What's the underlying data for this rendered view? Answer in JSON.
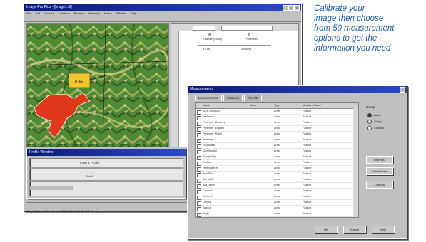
{
  "caption": {
    "lines": [
      "Calibrate your",
      "image then choose",
      "from 50 measurement",
      "options to get the",
      "information you need"
    ]
  },
  "main_window": {
    "title": "Image-Pro Plus - [Image1.tif]",
    "menu": [
      "File",
      "Edit",
      "Acquire",
      "Enhance",
      "Process",
      "Measure",
      "Macro",
      "Window",
      "Help"
    ],
    "spreadsheet": {
      "col_a": "A",
      "col_a_sub": "Feature (Count)",
      "col_b": "B",
      "col_b_sub": "Perimeter",
      "value_a": "87.15",
      "value_b": "2898.04"
    },
    "label_box": "Area",
    "status": "Inset 1 Data: 87 Ft. Cursor: 12,00 MSt: 0.12 Gsi: 4.5 Hz: 3",
    "colors": {
      "map_green": "#3f7a2e",
      "lake_red": "#e0381a",
      "label_yellow": "#f3c52b"
    }
  },
  "profile_window": {
    "title": "Profile Window",
    "labels": [
      "Inset 1 Profile",
      "Profile"
    ]
  },
  "measure_dialog": {
    "title": "Measurements",
    "tabs": [
      "Measurement",
      "Features",
      "Results"
    ],
    "columns": [
      "Name",
      "Value",
      "Type",
      "Measure Name"
    ],
    "rows": [
      {
        "name": "Area (Polygon)",
        "type": "Area",
        "measure": "Feature"
      },
      {
        "name": "Perimeter",
        "type": "Area",
        "measure": "Feature"
      },
      {
        "name": "Perimeter (Convex)",
        "type": "Area",
        "measure": "Feature"
      },
      {
        "name": "Perimeter (Ellipse)",
        "type": "Area",
        "measure": "Feature"
      },
      {
        "name": "Perimeter (Ratio)",
        "type": "Area",
        "measure": "Feature"
      },
      {
        "name": "Perimeter 2",
        "type": "Area",
        "measure": "Feature"
      },
      {
        "name": "Roundness",
        "type": "Area",
        "measure": "Feature"
      },
      {
        "name": "Size (length)",
        "type": "Area",
        "measure": "Feature"
      },
      {
        "name": "Size (width)",
        "type": "Area",
        "measure": "Feature"
      },
      {
        "name": "Radius",
        "type": "Area",
        "measure": "Feature"
      },
      {
        "name": "Heterogeneity",
        "type": "Area",
        "measure": "Feature"
      },
      {
        "name": "Area/Box",
        "type": "Area",
        "measure": "Feature"
      },
      {
        "name": "Box Width",
        "type": "Area",
        "measure": "Feature"
      },
      {
        "name": "Box Height",
        "type": "Area",
        "measure": "Feature"
      },
      {
        "name": "Center X",
        "type": "Area",
        "measure": "Feature"
      },
      {
        "name": "Center Y",
        "type": "Area",
        "measure": "Feature"
      },
      {
        "name": "Density",
        "type": "Area",
        "measure": "Feature"
      },
      {
        "name": "Aspect",
        "type": "Area",
        "measure": "Feature"
      },
      {
        "name": "Angle",
        "type": "Area",
        "measure": "Feature"
      },
      {
        "name": "Diameter",
        "type": "Area",
        "measure": "Feature"
      },
      {
        "name": "Dendrites",
        "type": "Area",
        "measure": "Feature"
      }
    ],
    "filter_label": "Group",
    "options": [
      "Basic",
      "Shape",
      "Custom"
    ],
    "side_buttons": [
      "Select All",
      "Select None",
      "Options"
    ],
    "bottom_buttons": [
      "OK",
      "Cancel",
      "Help"
    ]
  }
}
